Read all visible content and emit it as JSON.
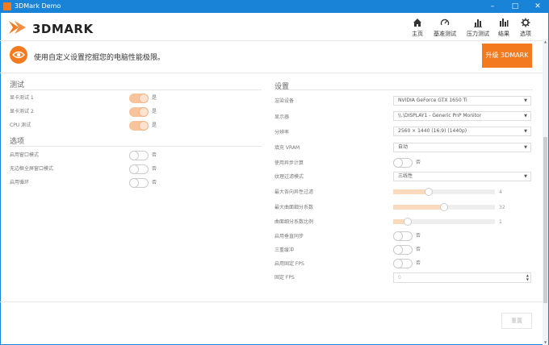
{
  "window": {
    "title": "3DMark Demo"
  },
  "logo": {
    "text": "3DMARK"
  },
  "nav": [
    {
      "label": "主页",
      "icon": "home-icon"
    },
    {
      "label": "基准测试",
      "icon": "gauge-icon"
    },
    {
      "label": "压力测试",
      "icon": "bar-chart-icon"
    },
    {
      "label": "结果",
      "icon": "results-chart-icon"
    },
    {
      "label": "选项",
      "icon": "gear-icon"
    }
  ],
  "promo": {
    "text": "使用自定义设置挖掘您的电脑性能极限。",
    "upgrade_label": "升级 3DMARK"
  },
  "tests": {
    "title": "测试",
    "items": [
      {
        "label": "显卡测试 1",
        "state": "是"
      },
      {
        "label": "显卡测试 2",
        "state": "是"
      },
      {
        "label": "CPU 测试",
        "state": "是"
      }
    ]
  },
  "options": {
    "title": "选项",
    "items": [
      {
        "label": "启用窗口模式",
        "state": "否"
      },
      {
        "label": "无边框全屏窗口模式",
        "state": "否"
      },
      {
        "label": "启用循环",
        "state": "否"
      }
    ]
  },
  "settings": {
    "title": "设置",
    "device_label": "渲染设备",
    "device_value": "NVIDIA GeForce GTX 1650 Ti",
    "display_label": "显示器",
    "display_value": "\\\\.\\DISPLAY1 - Generic PnP Monitor",
    "resolution_label": "分辨率",
    "resolution_value": "2560 × 1440 (16:9) (1440p)",
    "vram_label": "填充 VRAM",
    "vram_value": "自动",
    "async_label": "使用异步计算",
    "async_state": "否",
    "texfilter_label": "纹理过滤模式",
    "texfilter_value": "三线性",
    "aniso_label": "最大各向异性过滤",
    "aniso_value": "4",
    "aniso_fraction": 0.35,
    "tess_label": "最大曲面细分系数",
    "tess_value": "32",
    "tess_fraction": 0.5,
    "tessscale_label": "曲面细分系数比例",
    "tessscale_value": "1",
    "tessscale_fraction": 0.14,
    "vsync_label": "启用垂直同步",
    "vsync_state": "否",
    "triple_label": "三重缓冲",
    "triple_state": "否",
    "fixedfps_label": "启用固定 FPS",
    "fixedfps_state": "否",
    "fps_label": "固定 FPS",
    "fps_value": "0"
  },
  "reset_label": "重置",
  "colors": {
    "accent": "#f47a20",
    "titlebar": "#1883d7"
  }
}
